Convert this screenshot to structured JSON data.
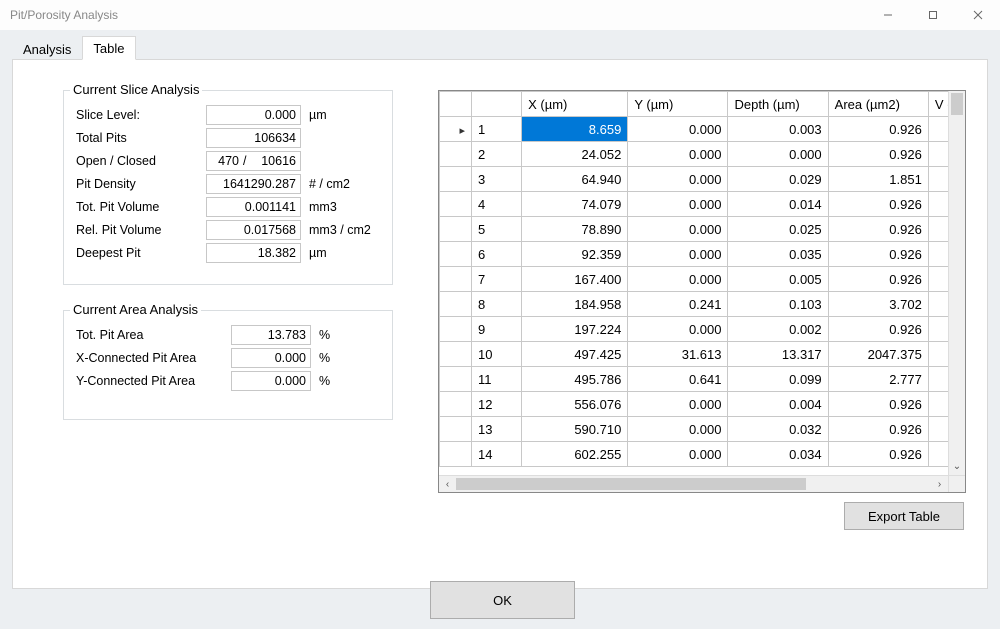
{
  "window": {
    "title": "Pit/Porosity Analysis"
  },
  "tabs": {
    "analysis": "Analysis",
    "table": "Table",
    "active": "table"
  },
  "slice_group": {
    "legend": "Current Slice Analysis",
    "rows": {
      "slice_level": {
        "label": "Slice Level:",
        "value": "0.000",
        "unit": "µm"
      },
      "total_pits": {
        "label": "Total Pits",
        "value": "106634",
        "unit": ""
      },
      "open_closed": {
        "label": "Open / Closed",
        "open": "470",
        "closed": "10616",
        "unit": ""
      },
      "pit_density": {
        "label": "Pit Density",
        "value": "1641290.287",
        "unit": "# / cm2"
      },
      "tot_pit_vol": {
        "label": "Tot. Pit Volume",
        "value": "0.001141",
        "unit": "mm3"
      },
      "rel_pit_vol": {
        "label": "Rel. Pit Volume",
        "value": "0.017568",
        "unit": "mm3 / cm2"
      },
      "deepest_pit": {
        "label": "Deepest Pit",
        "value": "18.382",
        "unit": "µm"
      }
    }
  },
  "area_group": {
    "legend": "Current Area Analysis",
    "rows": {
      "tot_pit_area": {
        "label": "Tot. Pit Area",
        "value": "13.783",
        "unit": "%"
      },
      "x_conn": {
        "label": "X-Connected Pit Area",
        "value": "0.000",
        "unit": "%"
      },
      "y_conn": {
        "label": "Y-Connected Pit Area",
        "value": "0.000",
        "unit": "%"
      }
    }
  },
  "table": {
    "columns": {
      "x": "X (µm)",
      "y": "Y (µm)",
      "depth": "Depth (µm)",
      "area": "Area (µm2)",
      "v": "V (µ"
    },
    "rows": [
      {
        "idx": "1",
        "x": "8.659",
        "y": "0.000",
        "depth": "0.003",
        "area": "0.926"
      },
      {
        "idx": "2",
        "x": "24.052",
        "y": "0.000",
        "depth": "0.000",
        "area": "0.926"
      },
      {
        "idx": "3",
        "x": "64.940",
        "y": "0.000",
        "depth": "0.029",
        "area": "1.851"
      },
      {
        "idx": "4",
        "x": "74.079",
        "y": "0.000",
        "depth": "0.014",
        "area": "0.926"
      },
      {
        "idx": "5",
        "x": "78.890",
        "y": "0.000",
        "depth": "0.025",
        "area": "0.926"
      },
      {
        "idx": "6",
        "x": "92.359",
        "y": "0.000",
        "depth": "0.035",
        "area": "0.926"
      },
      {
        "idx": "7",
        "x": "167.400",
        "y": "0.000",
        "depth": "0.005",
        "area": "0.926"
      },
      {
        "idx": "8",
        "x": "184.958",
        "y": "0.241",
        "depth": "0.103",
        "area": "3.702"
      },
      {
        "idx": "9",
        "x": "197.224",
        "y": "0.000",
        "depth": "0.002",
        "area": "0.926"
      },
      {
        "idx": "10",
        "x": "497.425",
        "y": "31.613",
        "depth": "13.317",
        "area": "2047.375"
      },
      {
        "idx": "11",
        "x": "495.786",
        "y": "0.641",
        "depth": "0.099",
        "area": "2.777"
      },
      {
        "idx": "12",
        "x": "556.076",
        "y": "0.000",
        "depth": "0.004",
        "area": "0.926"
      },
      {
        "idx": "13",
        "x": "590.710",
        "y": "0.000",
        "depth": "0.032",
        "area": "0.926"
      },
      {
        "idx": "14",
        "x": "602.255",
        "y": "0.000",
        "depth": "0.034",
        "area": "0.926"
      }
    ],
    "selected_index": 0
  },
  "buttons": {
    "export": "Export Table",
    "ok": "OK"
  }
}
